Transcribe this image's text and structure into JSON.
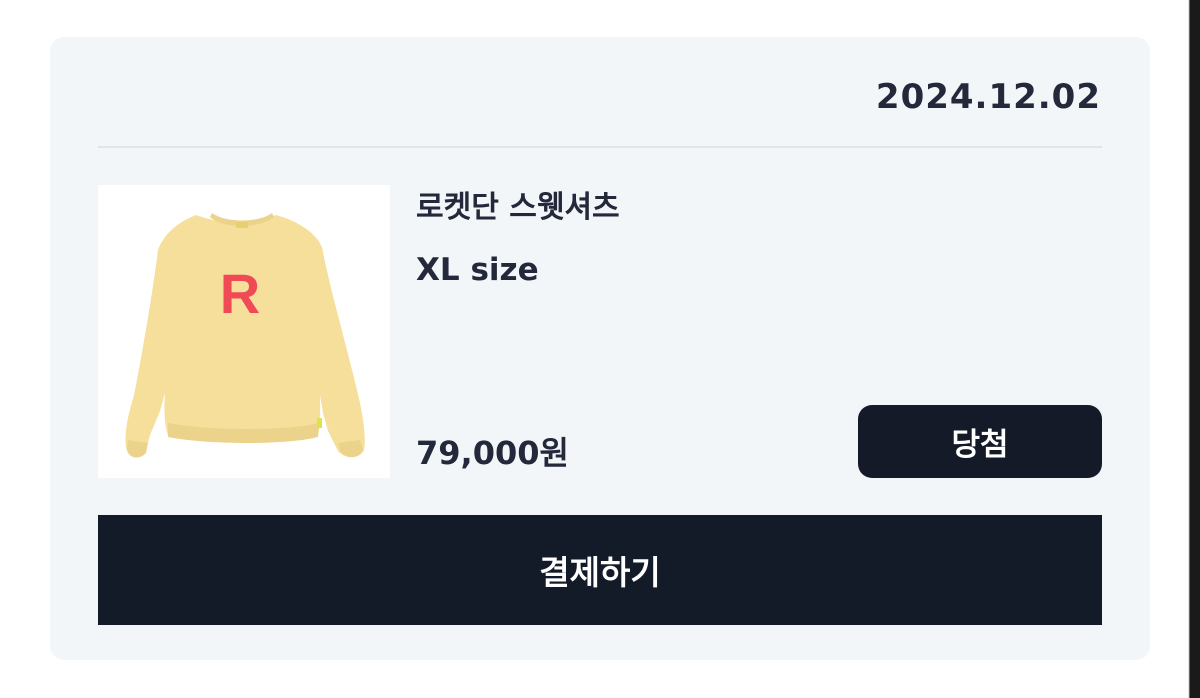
{
  "order": {
    "date": "2024.12.02",
    "product_name": "로켓단 스웻셔츠",
    "option": "XL size",
    "price": "79,000원",
    "status": "당첨",
    "pay_label": "결제하기",
    "image_letter": "R"
  },
  "colors": {
    "card_background": "#f2f6f9",
    "button_dark": "#131a28",
    "sweatshirt": "#f6df9b",
    "letter": "#f04a55"
  }
}
